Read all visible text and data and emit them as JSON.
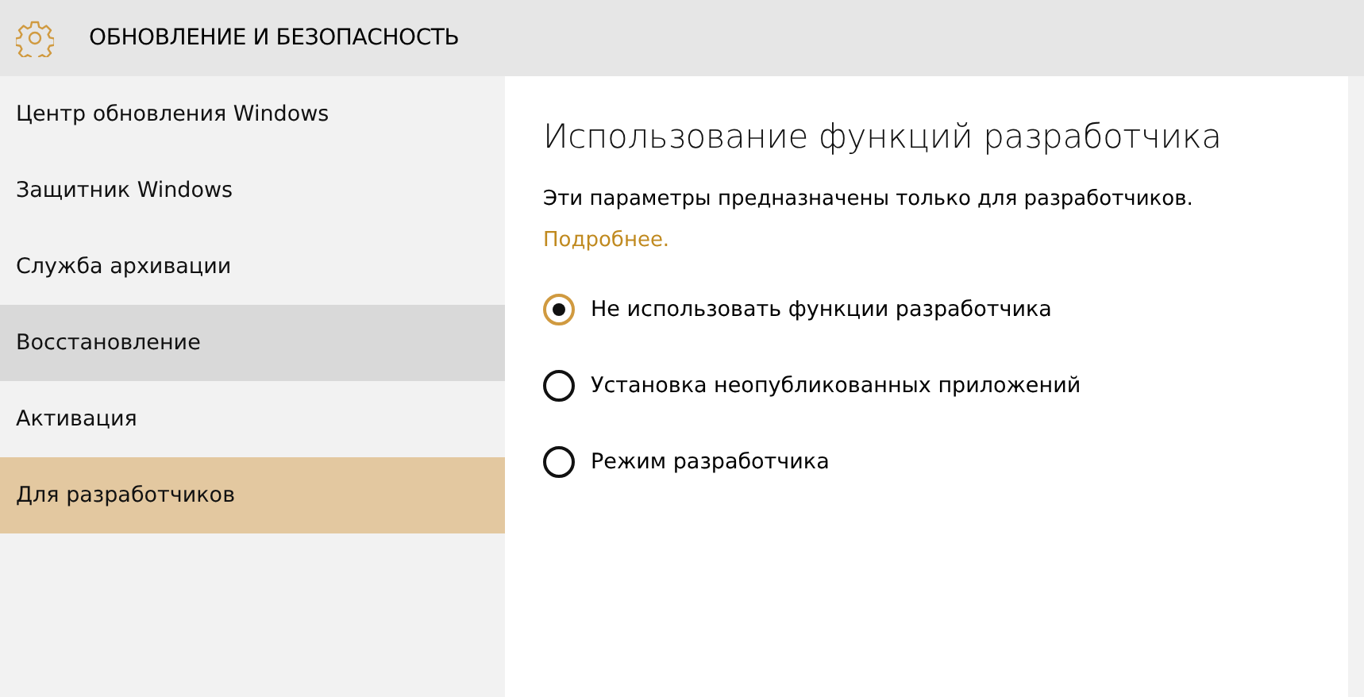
{
  "header": {
    "title": "ОБНОВЛЕНИЕ И БЕЗОПАСНОСТЬ"
  },
  "sidebar": {
    "items": [
      {
        "label": "Центр обновления Windows",
        "selected": false,
        "hovered": false
      },
      {
        "label": "Защитник Windows",
        "selected": false,
        "hovered": false
      },
      {
        "label": "Служба архивации",
        "selected": false,
        "hovered": false
      },
      {
        "label": "Восстановление",
        "selected": false,
        "hovered": true
      },
      {
        "label": "Активация",
        "selected": false,
        "hovered": false
      },
      {
        "label": "Для разработчиков",
        "selected": true,
        "hovered": false
      }
    ]
  },
  "content": {
    "title": "Использование функций разработчика",
    "description": "Эти параметры предназначены только для разработчиков.",
    "link": "Подробнее.",
    "options": [
      {
        "label": "Не использовать функции разработчика",
        "selected": true
      },
      {
        "label": "Установка неопубликованных приложений",
        "selected": false
      },
      {
        "label": "Режим разработчика",
        "selected": false
      }
    ]
  }
}
